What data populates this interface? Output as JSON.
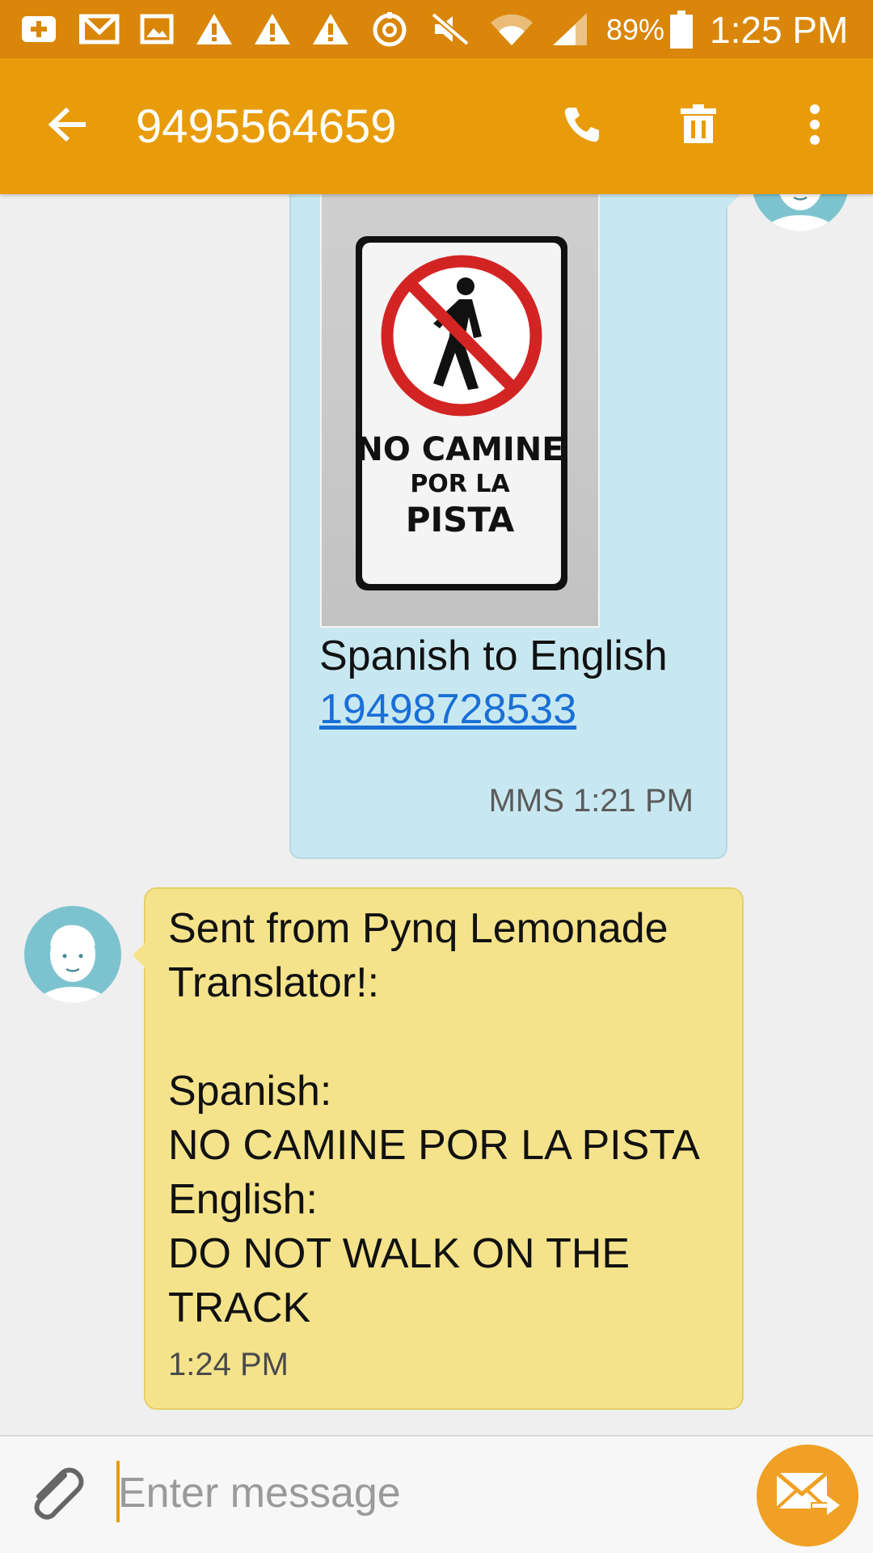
{
  "status_bar": {
    "battery": "89%",
    "time": "1:25 PM",
    "icons": [
      "add-icon",
      "gmail-icon",
      "gallery-icon",
      "warning-icon",
      "warning-icon",
      "warning-icon",
      "sync-icon",
      "mute-icon",
      "wifi-icon",
      "signal-icon",
      "battery-icon"
    ]
  },
  "header": {
    "title": "9495564659",
    "icons": [
      "back-arrow-icon",
      "phone-icon",
      "trash-icon",
      "more-vert-icon"
    ]
  },
  "messages": [
    {
      "direction": "outgoing",
      "attachment": {
        "type": "image",
        "sign_text": [
          "NO CAMINE",
          "POR LA",
          "PISTA"
        ]
      },
      "text": "Spanish to English",
      "link": "19498728533",
      "meta": "MMS 1:21 PM"
    },
    {
      "direction": "incoming",
      "text": "Sent from Pynq Lemonade\nTranslator!:\n\nSpanish:\nNO CAMINE POR LA PISTA\nEnglish:\nDO NOT WALK ON THE\nTRACK",
      "meta": "1:24 PM"
    }
  ],
  "composer": {
    "placeholder": "Enter message",
    "value": "",
    "icons": [
      "attach-icon",
      "send-icon"
    ]
  },
  "colors": {
    "status_bar": "#d9860a",
    "action_bar": "#e89c0c",
    "outgoing_bubble": "#c8e8f1",
    "incoming_bubble": "#f5e38c",
    "send_button": "#f0a024",
    "link": "#1a6fd6"
  }
}
